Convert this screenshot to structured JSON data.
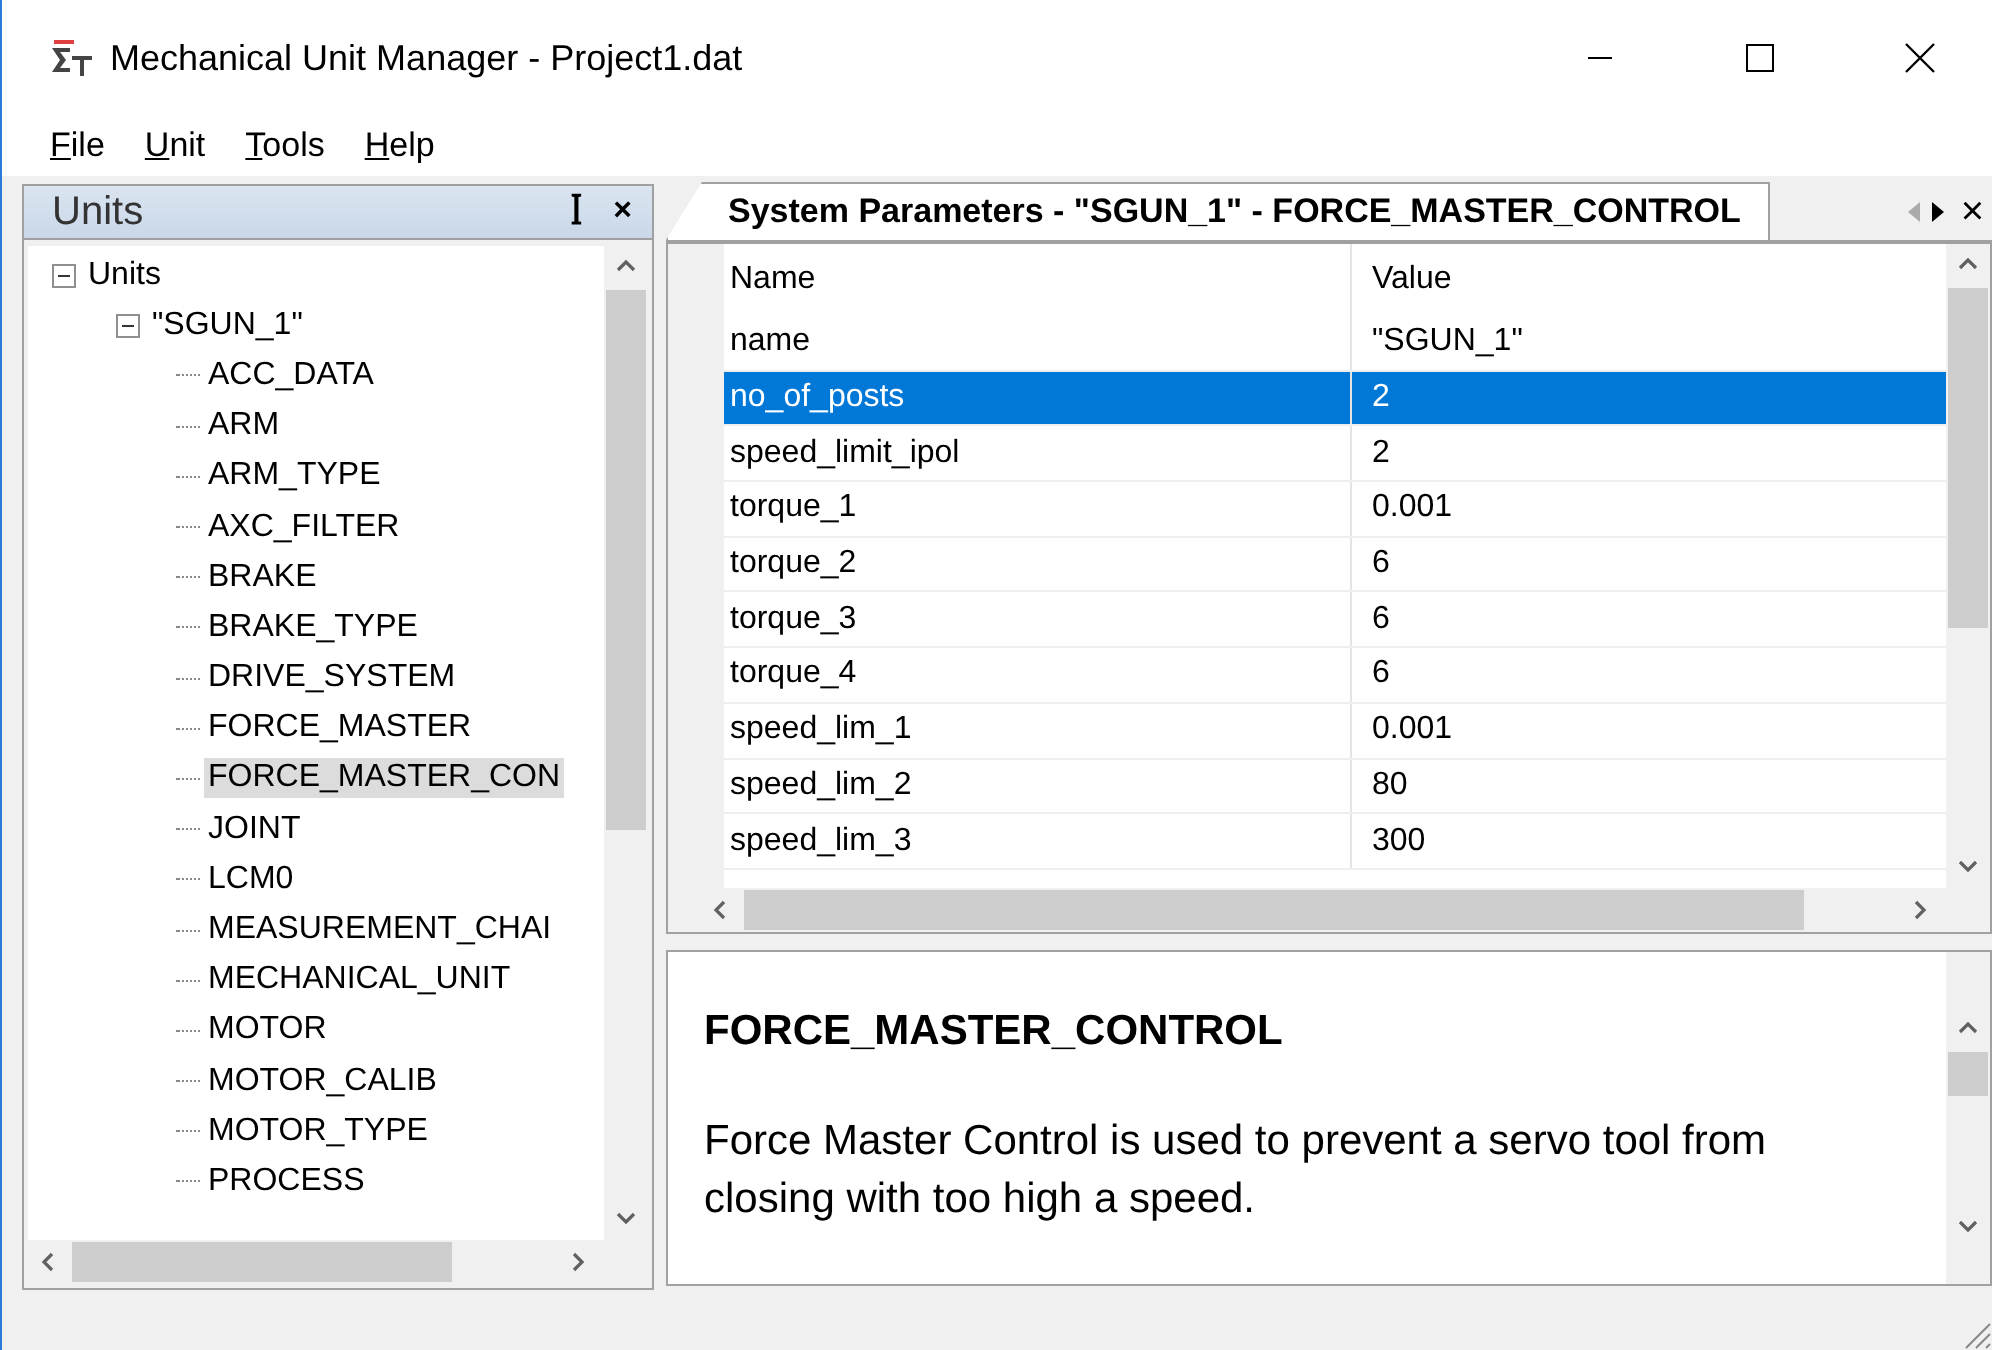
{
  "window": {
    "title": "Mechanical Unit Manager - Project1.dat"
  },
  "menu": [
    {
      "label": "File"
    },
    {
      "label": "Unit"
    },
    {
      "label": "Tools"
    },
    {
      "label": "Help"
    }
  ],
  "units_panel": {
    "title": "Units",
    "pin": "ꟾ",
    "close": "×",
    "tree": [
      {
        "label": "Units",
        "expanded": true,
        "selected": false,
        "children": [
          {
            "label": "\"SGUN_1\"",
            "expanded": true,
            "selected": false,
            "children": [
              {
                "label": "ACC_DATA",
                "selected": false
              },
              {
                "label": "ARM",
                "selected": false
              },
              {
                "label": "ARM_TYPE",
                "selected": false
              },
              {
                "label": "AXC_FILTER",
                "selected": false
              },
              {
                "label": "BRAKE",
                "selected": false
              },
              {
                "label": "BRAKE_TYPE",
                "selected": false
              },
              {
                "label": "DRIVE_SYSTEM",
                "selected": false
              },
              {
                "label": "FORCE_MASTER",
                "selected": false
              },
              {
                "label": "FORCE_MASTER_CON",
                "selected": true
              },
              {
                "label": "JOINT",
                "selected": false
              },
              {
                "label": "LCM0",
                "selected": false
              },
              {
                "label": "MEASUREMENT_CHAI",
                "selected": false
              },
              {
                "label": "MECHANICAL_UNIT",
                "selected": false
              },
              {
                "label": "MOTOR",
                "selected": false
              },
              {
                "label": "MOTOR_CALIB",
                "selected": false
              },
              {
                "label": "MOTOR_TYPE",
                "selected": false
              },
              {
                "label": "PROCESS",
                "selected": false
              }
            ]
          }
        ]
      }
    ]
  },
  "document_tab": {
    "title": "System Parameters - \"SGUN_1\" - FORCE_MASTER_CONTROL",
    "close": "×"
  },
  "table": {
    "columns": [
      "Name",
      "Value"
    ],
    "rows": [
      {
        "name": "name",
        "value": "\"SGUN_1\"",
        "selected": false
      },
      {
        "name": "no_of_posts",
        "value": "2",
        "selected": true
      },
      {
        "name": "speed_limit_ipol",
        "value": "2",
        "selected": false
      },
      {
        "name": "torque_1",
        "value": "0.001",
        "selected": false
      },
      {
        "name": "torque_2",
        "value": "6",
        "selected": false
      },
      {
        "name": "torque_3",
        "value": "6",
        "selected": false
      },
      {
        "name": "torque_4",
        "value": "6",
        "selected": false
      },
      {
        "name": "speed_lim_1",
        "value": "0.001",
        "selected": false
      },
      {
        "name": "speed_lim_2",
        "value": "80",
        "selected": false
      },
      {
        "name": "speed_lim_3",
        "value": "300",
        "selected": false
      }
    ]
  },
  "description": {
    "heading": "FORCE_MASTER_CONTROL",
    "text": "Force Master Control is used to prevent a servo tool from closing with too high a speed."
  }
}
